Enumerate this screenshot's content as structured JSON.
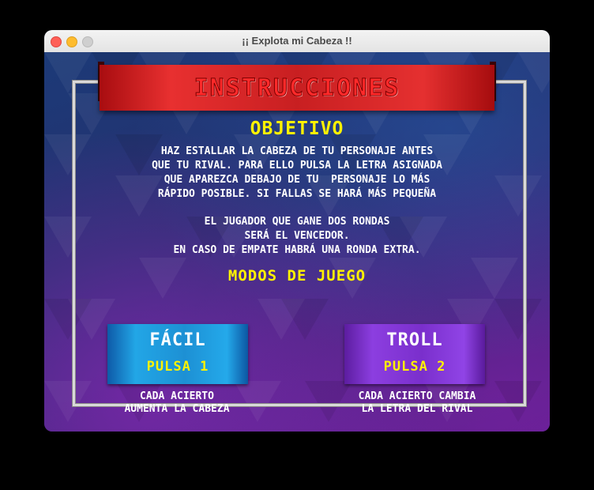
{
  "window": {
    "title": "¡¡ Explota mi Cabeza !!"
  },
  "banner": {
    "title": "INSTRUCCIONES"
  },
  "objective": {
    "heading": "OBJETIVO",
    "lines": [
      "HAZ ESTALLAR LA CABEZA DE TU PERSONAJE ANTES",
      "QUE TU RIVAL. PARA ELLO PULSA LA LETRA ASIGNADA",
      "QUE APAREZCA DEBAJO DE TU  PERSONAJE LO MÁS",
      "RÁPIDO POSIBLE. SI FALLAS SE HARÁ MÁS PEQUEÑA"
    ],
    "rules": [
      "EL JUGADOR QUE GANE DOS RONDAS",
      "SERÁ EL VENCEDOR.",
      "EN CASO DE EMPATE HABRÁ UNA RONDA EXTRA."
    ]
  },
  "modes": {
    "heading": "MODOS DE JUEGO",
    "items": [
      {
        "name": "FÁCIL",
        "key": "PULSA 1",
        "desc": [
          "CADA ACIERTO",
          "AUMENTA LA CABEZA"
        ]
      },
      {
        "name": "TROLL",
        "key": "PULSA 2",
        "desc": [
          "CADA ACIERTO CAMBIA",
          "LA LETRA DEL RIVAL"
        ]
      }
    ]
  },
  "colors": {
    "banner_red": "#e83030",
    "heading_yellow": "#fff200",
    "facil_blue": "#22a6e6",
    "troll_purple": "#8c3ee0"
  }
}
